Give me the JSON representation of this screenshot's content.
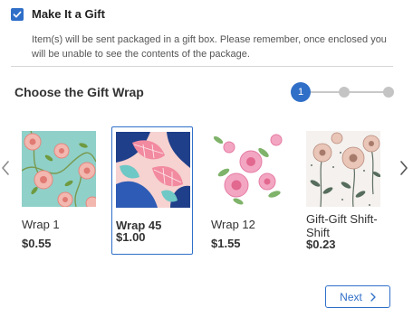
{
  "gift": {
    "checked": true,
    "label": "Make It a Gift",
    "description": "Item(s) will be sent packaged in a gift box. Please remember, once enclosed you will be unable to see the contents of the package."
  },
  "section_title": "Choose the Gift Wrap",
  "stepper": {
    "current": "1",
    "total": 3
  },
  "wraps": [
    {
      "name": "Wrap 1",
      "price": "$0.55",
      "selected": false
    },
    {
      "name": "Wrap 45",
      "price": "$1.00",
      "selected": true
    },
    {
      "name": "Wrap 12",
      "price": "$1.55",
      "selected": false
    },
    {
      "name": "Gift-Gift Shift-Shift",
      "price": "$0.23",
      "selected": false
    }
  ],
  "next_label": "Next",
  "colors": {
    "accent": "#2f6fc8",
    "divider": "#d6d6d6",
    "step_inactive": "#c4c4c4"
  },
  "icons": {
    "checkbox": "check-icon",
    "carousel_prev": "chevron-left-icon",
    "carousel_next": "chevron-right-icon",
    "next": "chevron-right-icon"
  }
}
